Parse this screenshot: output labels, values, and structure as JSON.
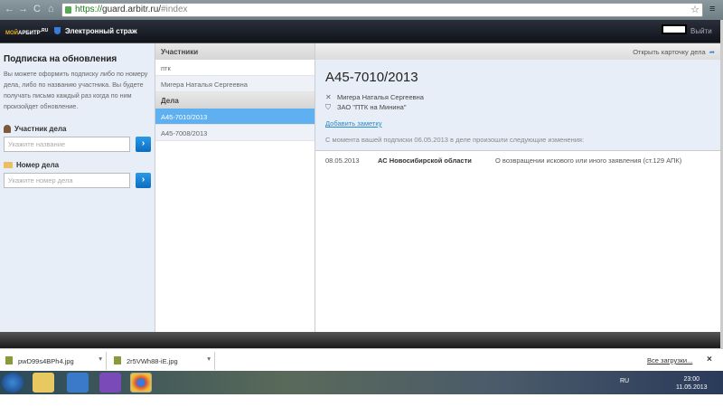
{
  "browser": {
    "url_scheme": "https://",
    "url_host": "guard.arbitr.ru/",
    "url_hash": "#index",
    "back": "←",
    "forward": "→",
    "reload": "C",
    "home": "⌂",
    "star": "☆",
    "menu": "≡"
  },
  "header": {
    "logo_a": "МОЙ",
    "logo_b": "АРБИТР",
    "logo_c": ".RU",
    "service": "Электронный страж",
    "logout": "Выйти"
  },
  "left": {
    "title": "Подписка на обновления",
    "description": "Вы можете оформить подписку либо по номеру дела, либо по названию участника. Вы будете получать письмо каждый раз когда по ним произойдет обновление.",
    "participant_label": "Участник дела",
    "participant_placeholder": "Укажите название",
    "case_label": "Номер дела",
    "case_placeholder": "Укажите номер дела",
    "go": "›"
  },
  "middle": {
    "participants_header": "Участники",
    "participants": [
      "птк",
      "Мигера Наталья Сергеевна"
    ],
    "cases_header": "Дела",
    "cases": [
      "А45-7010/2013",
      "А45-7008/2013"
    ]
  },
  "right": {
    "open_card": "Открыть карточку дела",
    "case_number": "А45-7010/2013",
    "party1": "Мигера Наталья Сергеевна",
    "party2": "ЗАО \"ПТК на Минина\"",
    "add_note": "Добавить заметку",
    "since": "С момента вашей подписки 06.05.2013 в деле произошли следующие изменения:",
    "event": {
      "date": "08.05.2013",
      "court": "АС Новосибирской области",
      "text": "О возвращении искового или иного заявления (ст.129 АПК)"
    }
  },
  "downloads": {
    "items": [
      "pwD99s4BPh4.jpg",
      "2r5VWh88-iE.jpg"
    ],
    "all": "Все загрузки...",
    "close": "×"
  },
  "taskbar": {
    "lang": "RU",
    "time": "23:00",
    "date": "11.05.2013"
  }
}
